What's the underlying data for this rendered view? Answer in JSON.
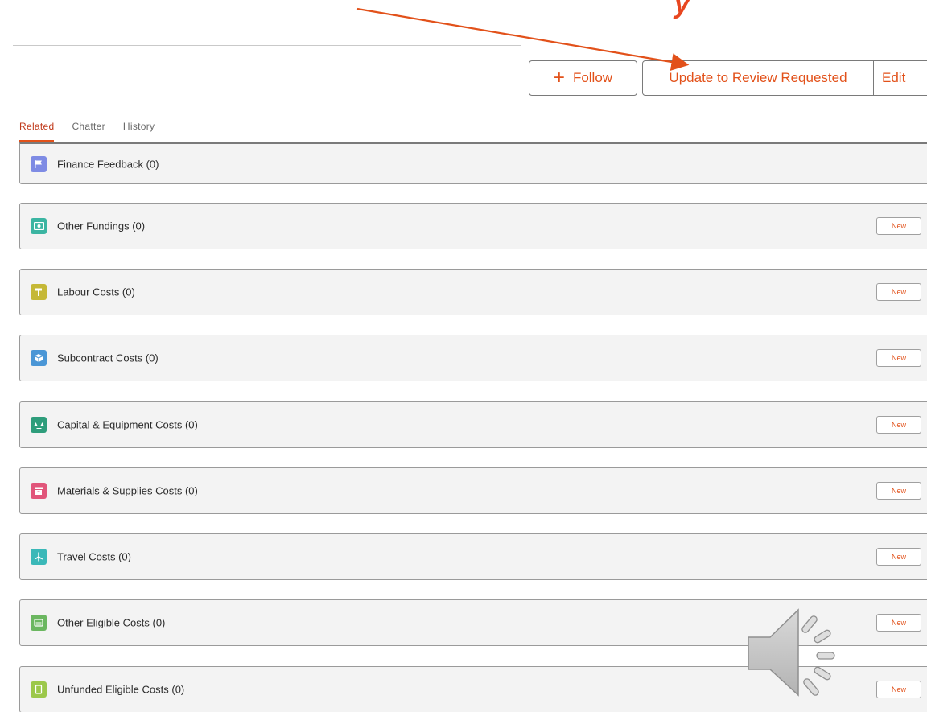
{
  "toolbar": {
    "follow_label": "Follow",
    "update_label": "Update to Review Requested",
    "edit_label": "Edit"
  },
  "tabs": [
    {
      "label": "Related",
      "active": true
    },
    {
      "label": "Chatter",
      "active": false
    },
    {
      "label": "History",
      "active": false
    }
  ],
  "related_lists": [
    {
      "title": "Finance Feedback (0)",
      "icon": "flag-icon",
      "icon_color": "#7e8be4",
      "has_new": false
    },
    {
      "title": "Other Fundings (0)",
      "icon": "money-icon",
      "icon_color": "#3bb5a2",
      "has_new": true,
      "new_label": "New"
    },
    {
      "title": "Labour Costs (0)",
      "icon": "hammer-icon",
      "icon_color": "#c5b836",
      "has_new": true,
      "new_label": "New"
    },
    {
      "title": "Subcontract Costs (0)",
      "icon": "cube-icon",
      "icon_color": "#4a96d6",
      "has_new": true,
      "new_label": "New"
    },
    {
      "title": "Capital & Equipment Costs (0)",
      "icon": "scales-icon",
      "icon_color": "#2e9d7b",
      "has_new": true,
      "new_label": "New"
    },
    {
      "title": "Materials & Supplies Costs (0)",
      "icon": "archive-icon",
      "icon_color": "#e1557a",
      "has_new": true,
      "new_label": "New"
    },
    {
      "title": "Travel Costs (0)",
      "icon": "plane-icon",
      "icon_color": "#3ab8b8",
      "has_new": true,
      "new_label": "New"
    },
    {
      "title": "Other Eligible Costs (0)",
      "icon": "calculator-icon",
      "icon_color": "#6bb760",
      "has_new": true,
      "new_label": "New"
    },
    {
      "title": "Unfunded Eligible Costs (0)",
      "icon": "tablet-icon",
      "icon_color": "#9cc84a",
      "has_new": true,
      "new_label": "New"
    }
  ],
  "colors": {
    "accent": "#e2511a",
    "arrow": "#e2511a"
  }
}
